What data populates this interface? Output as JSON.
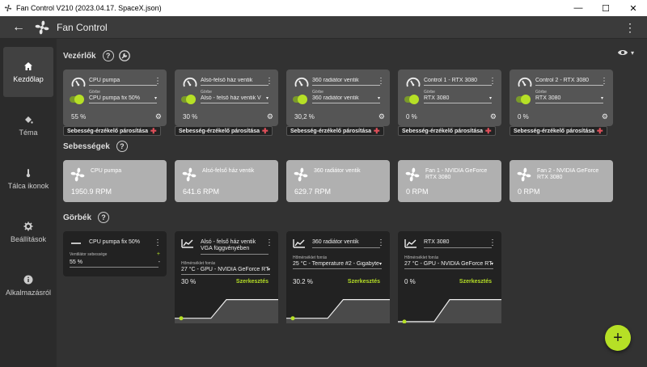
{
  "window": {
    "title": "Fan Control V210 (2023.04.17. SpaceX.json)",
    "minimize": "—",
    "maximize": "☐",
    "close": "✕"
  },
  "appbar": {
    "title": "Fan Control",
    "back": "←",
    "menu": "⋮"
  },
  "sidebar": {
    "items": [
      {
        "label": "Kezdőlap",
        "icon": "home-icon",
        "active": true
      },
      {
        "label": "Téma",
        "icon": "paint-bucket-icon"
      },
      {
        "label": "Tálca ikonok",
        "icon": "thermometer-icon"
      },
      {
        "label": "Beállítások",
        "icon": "gear-icon"
      },
      {
        "label": "Alkalmazásról",
        "icon": "info-icon"
      }
    ]
  },
  "sections": {
    "controls": "Vezérlők",
    "speeds": "Sebességek",
    "curves": "Görbék",
    "help": "?"
  },
  "controls": [
    {
      "name": "CPU pumpa",
      "curve_label": "Görbe",
      "curve": "CPU pumpa fix 50%",
      "percent": "55 %",
      "pair": "Sebesség-érzékelő párosítása"
    },
    {
      "name": "Alsó-felső ház ventik",
      "curve_label": "Görbe",
      "curve": "Alsó - felső ház ventik V",
      "percent": "30 %",
      "pair": "Sebesség-érzékelő párosítása"
    },
    {
      "name": "360 radiátor ventik",
      "curve_label": "Görbe",
      "curve": "360 radiátor ventik",
      "percent": "30,2 %",
      "pair": "Sebesség-érzékelő párosítása"
    },
    {
      "name": "Control 1 - RTX 3080",
      "curve_label": "Görbe",
      "curve": "RTX 3080",
      "percent": "0 %",
      "pair": "Sebesség-érzékelő párosítása"
    },
    {
      "name": "Control 2 - RTX 3080",
      "curve_label": "Görbe",
      "curve": "RTX 3080",
      "percent": "0 %",
      "pair": "Sebesség-érzékelő párosítása"
    }
  ],
  "speeds": [
    {
      "name": "CPU pumpa",
      "rpm": "1950.9 RPM"
    },
    {
      "name": "Alsó-felső ház ventik",
      "rpm": "641.6 RPM"
    },
    {
      "name": "360 radiátor ventik",
      "rpm": "629.7 RPM"
    },
    {
      "name": "Fan 1 - NVIDIA GeForce RTX 3080",
      "rpm": "0 RPM"
    },
    {
      "name": "Fan 2 - NVIDIA GeForce RTX 3080",
      "rpm": "0 RPM"
    }
  ],
  "curves": [
    {
      "name": "CPU pumpa fix 50%",
      "label": "Ventilátor sebessége",
      "value": "55 %",
      "plus": "+",
      "minus": "-"
    },
    {
      "name": "Alsó - felső ház ventik VGA függvényében",
      "label": "Hőmérséklet forrás",
      "value": "27 °C - GPU - NVIDIA GeForce RT",
      "percent": "30 %",
      "edit": "Szerkesztés",
      "graph": [
        [
          0,
          0.85
        ],
        [
          0.35,
          0.85
        ],
        [
          0.5,
          0.3
        ],
        [
          1,
          0.3
        ]
      ]
    },
    {
      "name": "360 radiátor ventik",
      "label": "Hőmérséklet forrás",
      "value": "25 °C - Temperature #2 - Gigabyte",
      "percent": "30.2 %",
      "edit": "Szerkesztés",
      "graph": [
        [
          0,
          0.85
        ],
        [
          0.4,
          0.85
        ],
        [
          0.55,
          0.3
        ],
        [
          1,
          0.3
        ]
      ]
    },
    {
      "name": "RTX 3080",
      "label": "Hőmérséklet forrás",
      "value": "27 °C - GPU - NVIDIA GeForce RT",
      "percent": "0 %",
      "edit": "Szerkesztés",
      "graph": [
        [
          0,
          0.95
        ],
        [
          0.35,
          0.95
        ],
        [
          0.5,
          0.3
        ],
        [
          1,
          0.3
        ]
      ]
    }
  ],
  "fab": "+",
  "colors": {
    "accent": "#b6e026",
    "pair_plus": "#e0505a"
  }
}
